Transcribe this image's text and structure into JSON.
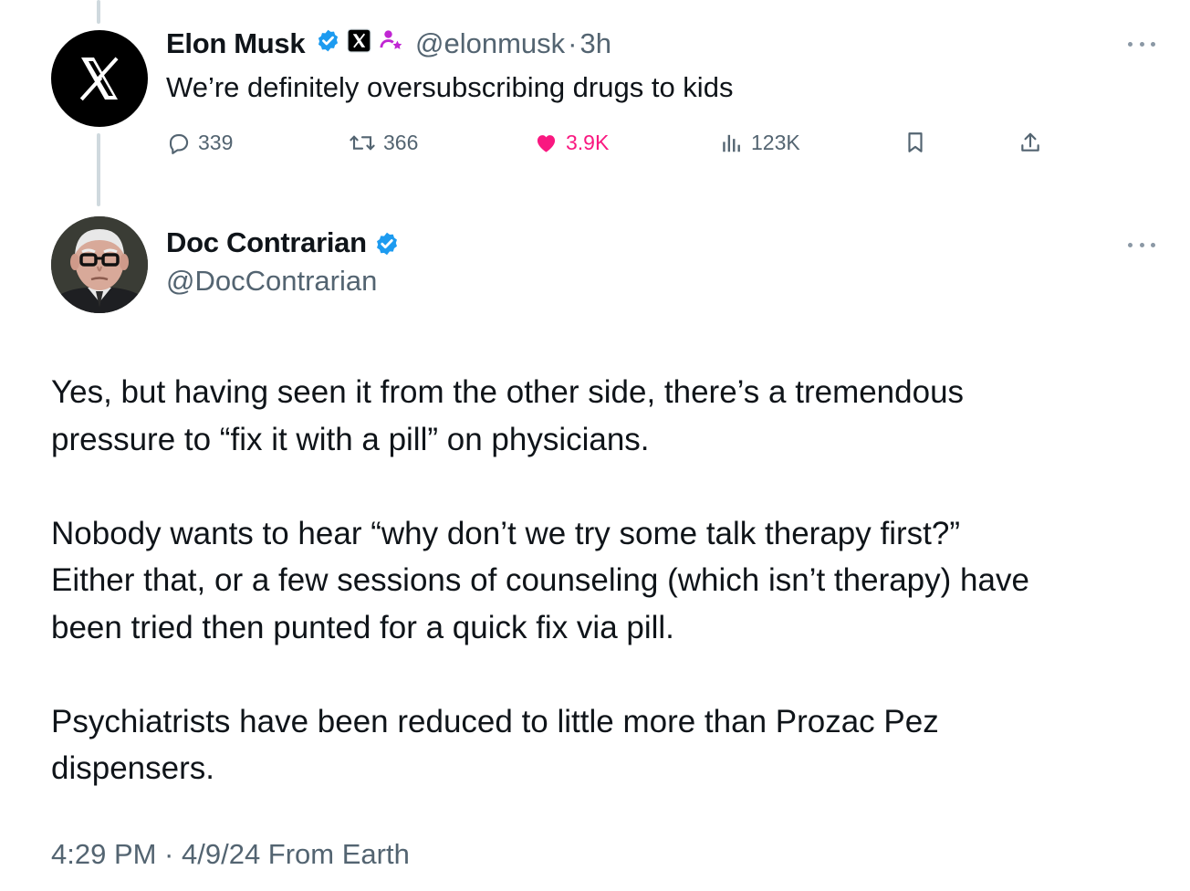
{
  "colors": {
    "text_primary": "#0f1419",
    "text_secondary": "#536471",
    "verified_blue": "#1d9bf0",
    "like_pink": "#f91880",
    "thread_line": "#cfd9de"
  },
  "quoted_tweet": {
    "author_name": "Elon Musk",
    "avatar_icon": "x-logo-icon",
    "badges": [
      "verified-badge-icon",
      "x-affiliate-badge-icon",
      "parody-person-icon"
    ],
    "handle": "@elonmusk",
    "separator": "·",
    "time": "3h",
    "text": "We’re definitely oversubscribing drugs to kids",
    "stats": {
      "replies": "339",
      "retweets": "366",
      "likes": "3.9K",
      "views": "123K"
    }
  },
  "main_tweet": {
    "author_name": "Doc Contrarian",
    "handle": "@DocContrarian",
    "paragraphs": [
      [
        "Yes, but having seen it from the other side, there’s a tremendous",
        "pressure to “fix it with a pill” on physicians."
      ],
      [
        "Nobody wants to hear “why don’t we try some talk therapy first?”",
        "Either that, or a few sessions of counseling (which isn’t therapy) have",
        "been tried then punted for a quick fix via pill."
      ],
      [
        "Psychiatrists have been reduced to little more than Prozac Pez",
        "dispensers."
      ]
    ],
    "timestamp": "4:29 PM · 4/9/24 From Earth"
  }
}
